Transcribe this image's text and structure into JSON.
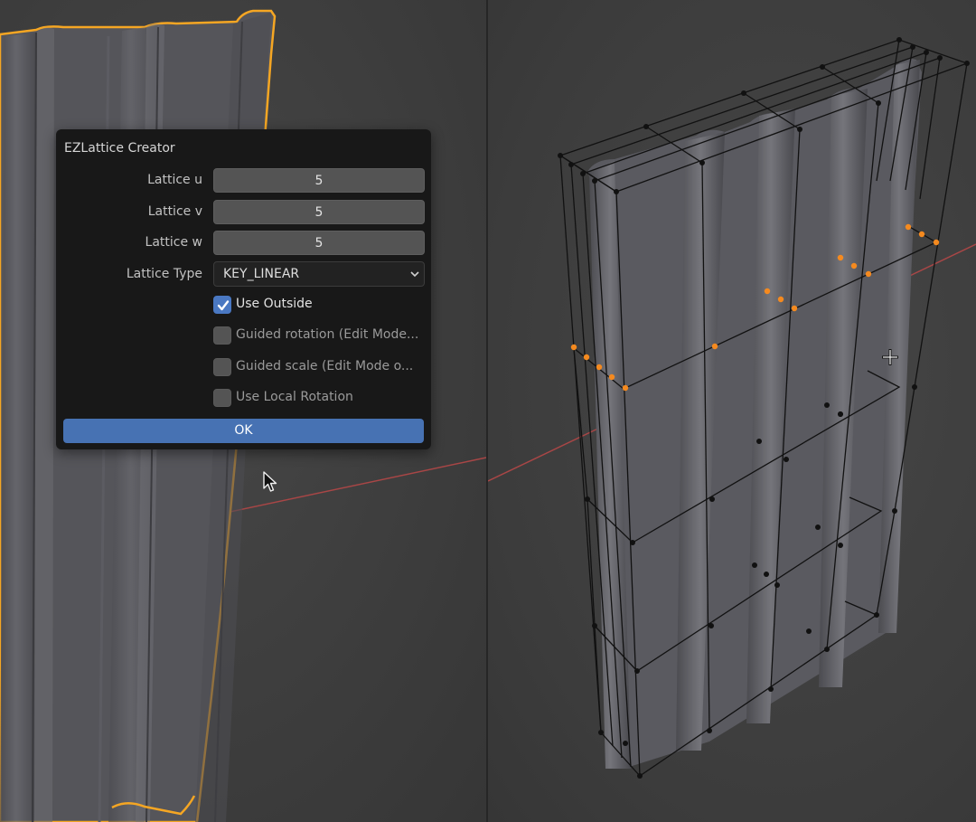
{
  "dialog": {
    "title": "EZLattice Creator",
    "fields": [
      {
        "label": "Lattice u",
        "value": "5"
      },
      {
        "label": "Lattice v",
        "value": "5"
      },
      {
        "label": "Lattice w",
        "value": "5"
      }
    ],
    "lattice_type": {
      "label": "Lattice Type",
      "value": "KEY_LINEAR"
    },
    "checkboxes": [
      {
        "label": "Use Outside",
        "checked": true
      },
      {
        "label": "Guided rotation (Edit Mode...",
        "checked": false
      },
      {
        "label": "Guided scale (Edit Mode o...",
        "checked": false
      },
      {
        "label": "Use Local Rotation",
        "checked": false
      }
    ],
    "ok_label": "OK"
  },
  "colors": {
    "selection_outline": "#f5a623",
    "selected_vertex": "#f58a1f",
    "x_axis": "#b04848",
    "button_accent": "#4772b3",
    "checkbox_checked": "#4a78c2"
  },
  "icons": {
    "cursor": "mouse-pointer-icon",
    "crosshair": "cursor-crosshair-icon",
    "checkmark": "checkmark-icon",
    "chevron": "chevron-down-icon"
  }
}
